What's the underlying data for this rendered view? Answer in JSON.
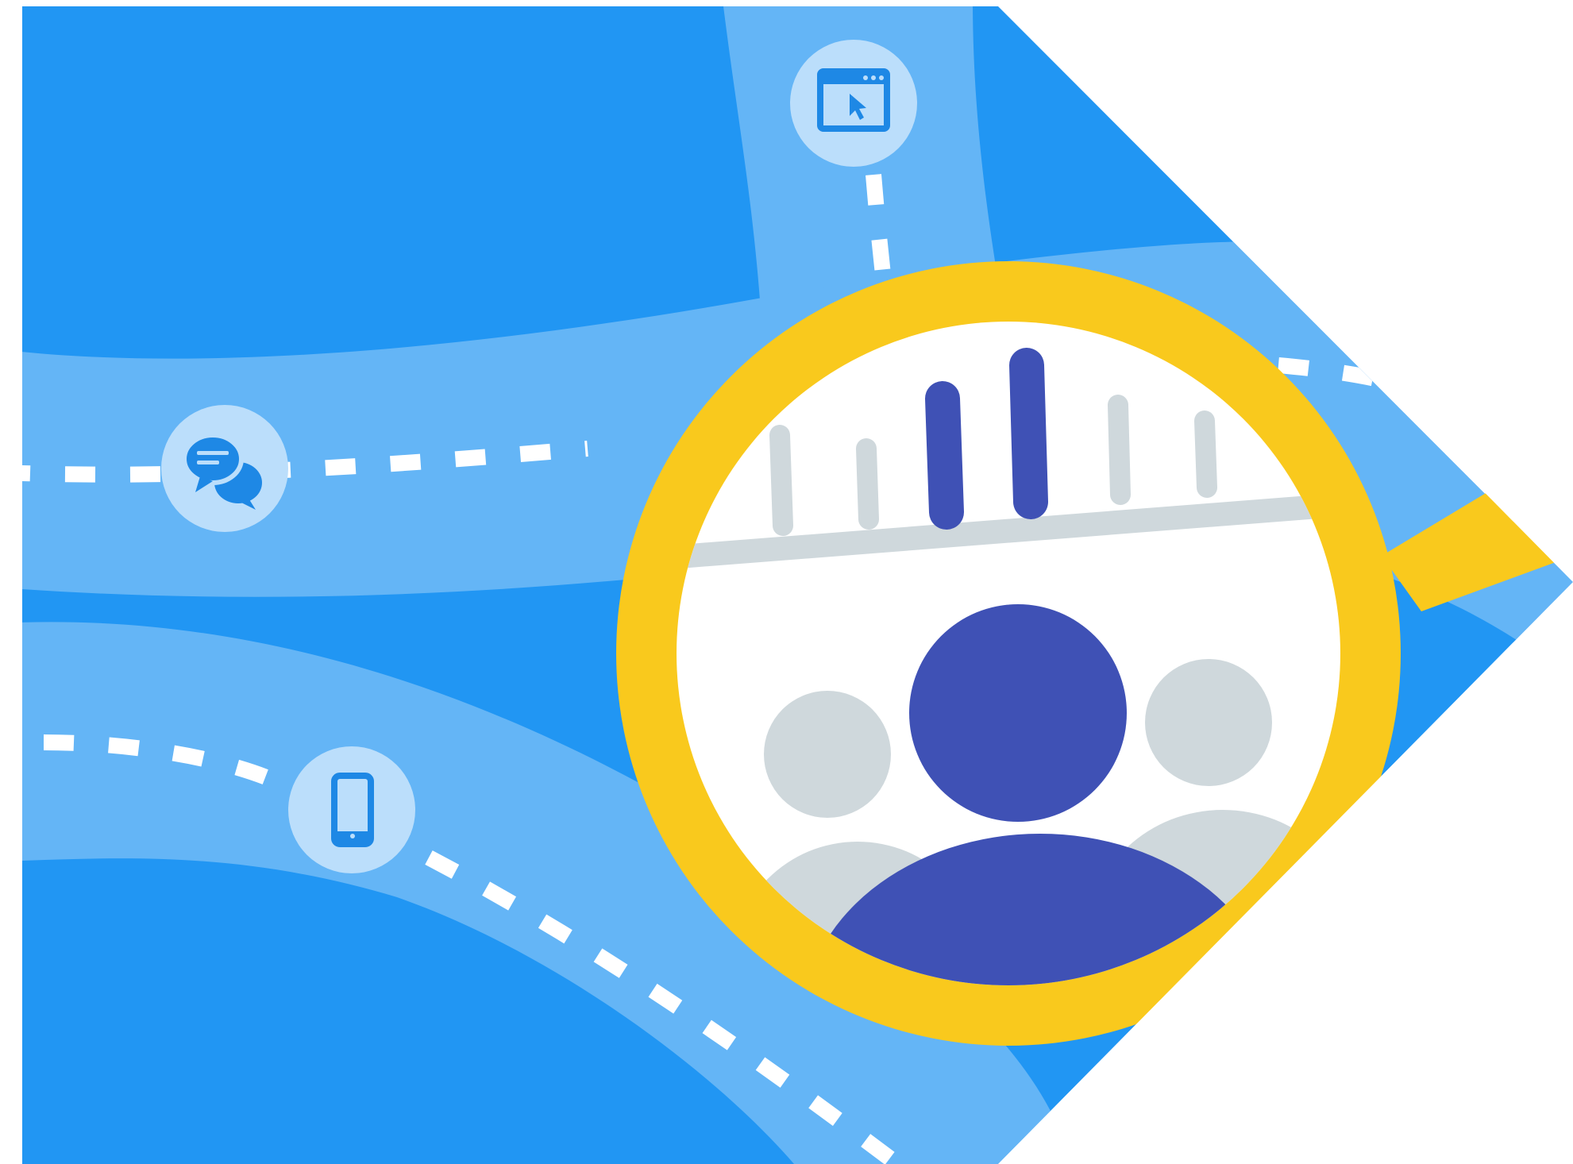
{
  "palette": {
    "background": "#ffffff",
    "deep_blue": "#2196f3",
    "path_blue": "#64b5f6",
    "node_blue": "#bbdefb",
    "icon_blue": "#1e88e5",
    "lens_yellow": "#f9c91d",
    "lens_white": "#ffffff",
    "indigo": "#3f51b5",
    "gray": "#cfd8dc",
    "dash_white": "#ffffff"
  },
  "icons": {
    "channel_web": "browser-cursor-icon",
    "channel_chat": "chat-bubbles-icon",
    "channel_mobile": "smartphone-icon",
    "lens": "magnifying-glass-icon",
    "audience": "people-group-icon",
    "bars": "bar-meter-icon"
  },
  "meter": {
    "highlighted": [
      3,
      4
    ]
  }
}
